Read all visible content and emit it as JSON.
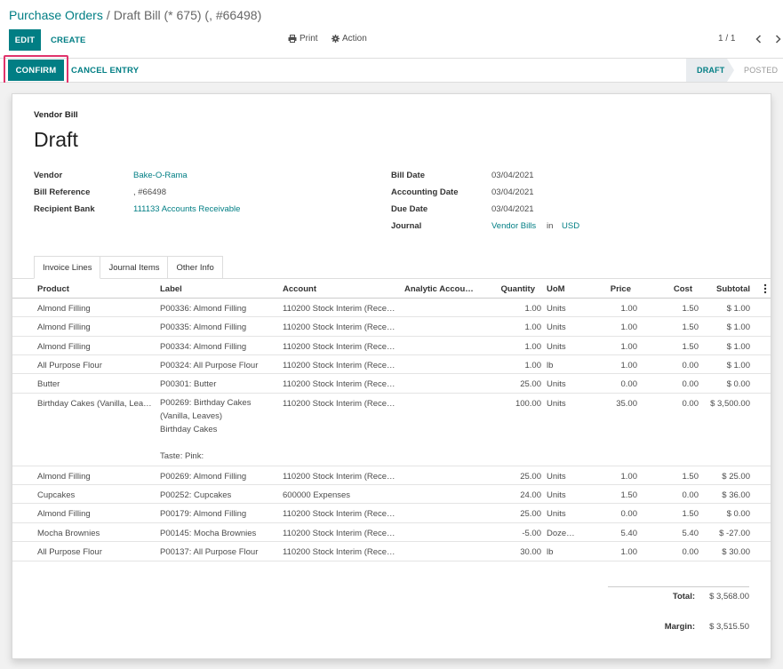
{
  "breadcrumb": {
    "parent": "Purchase Orders",
    "separator": "/",
    "current": "Draft Bill (* 675) (, #66498)"
  },
  "toolbar": {
    "edit_label": "EDIT",
    "create_label": "CREATE",
    "print_label": "Print",
    "action_label": "Action",
    "pager": "1 / 1"
  },
  "statusbar": {
    "confirm_label": "CONFIRM",
    "cancel_label": "CANCEL ENTRY",
    "stages": [
      "DRAFT",
      "POSTED"
    ],
    "active_stage": "DRAFT"
  },
  "form": {
    "doc_type": "Vendor Bill",
    "title": "Draft",
    "left_fields": [
      {
        "label": "Vendor",
        "value": "Bake-O-Rama",
        "link": true
      },
      {
        "label": "Bill Reference",
        "value": ", #66498",
        "link": false
      },
      {
        "label": "Recipient Bank",
        "value": "111133 Accounts Receivable",
        "link": true
      }
    ],
    "right_fields": [
      {
        "label": "Bill Date",
        "value": "03/04/2021"
      },
      {
        "label": "Accounting Date",
        "value": "03/04/2021"
      },
      {
        "label": "Due Date",
        "value": "03/04/2021"
      },
      {
        "label": "Journal",
        "value": "Vendor Bills",
        "in": "in",
        "currency": "USD"
      }
    ]
  },
  "tabs": [
    "Invoice Lines",
    "Journal Items",
    "Other Info"
  ],
  "table": {
    "headers": [
      "Product",
      "Label",
      "Account",
      "Analytic Accou…",
      "Quantity",
      "UoM",
      "Price",
      "Cost",
      "Subtotal"
    ],
    "rows": [
      {
        "product": "Almond Filling",
        "label": "P00336: Almond Filling",
        "account": "110200 Stock Interim (Rece…",
        "qty": "1.00",
        "uom": "Units",
        "price": "1.00",
        "cost": "1.50",
        "subtotal": "$ 1.00"
      },
      {
        "product": "Almond Filling",
        "label": "P00335: Almond Filling",
        "account": "110200 Stock Interim (Rece…",
        "qty": "1.00",
        "uom": "Units",
        "price": "1.00",
        "cost": "1.50",
        "subtotal": "$ 1.00"
      },
      {
        "product": "Almond Filling",
        "label": "P00334: Almond Filling",
        "account": "110200 Stock Interim (Rece…",
        "qty": "1.00",
        "uom": "Units",
        "price": "1.00",
        "cost": "1.50",
        "subtotal": "$ 1.00"
      },
      {
        "product": "All Purpose Flour",
        "label": "P00324: All Purpose Flour",
        "account": "110200 Stock Interim (Rece…",
        "qty": "1.00",
        "uom": "lb",
        "price": "1.00",
        "cost": "0.00",
        "subtotal": "$ 1.00"
      },
      {
        "product": "Butter",
        "label": "P00301: Butter",
        "account": "110200 Stock Interim (Rece…",
        "qty": "25.00",
        "uom": "Units",
        "price": "0.00",
        "cost": "0.00",
        "subtotal": "$ 0.00"
      },
      {
        "product": "Birthday Cakes (Vanilla, Lea…",
        "label_lines": [
          "P00269: Birthday Cakes",
          "(Vanilla, Leaves)",
          "Birthday Cakes",
          "",
          "Taste: Pink:"
        ],
        "account": "110200 Stock Interim (Rece…",
        "qty": "100.00",
        "uom": "Units",
        "price": "35.00",
        "cost": "0.00",
        "subtotal": "$ 3,500.00"
      },
      {
        "product": "Almond Filling",
        "label": "P00269: Almond Filling",
        "account": "110200 Stock Interim (Rece…",
        "qty": "25.00",
        "uom": "Units",
        "price": "1.00",
        "cost": "1.50",
        "subtotal": "$ 25.00"
      },
      {
        "product": "Cupcakes",
        "label": "P00252: Cupcakes",
        "account": "600000 Expenses",
        "qty": "24.00",
        "uom": "Units",
        "price": "1.50",
        "cost": "0.00",
        "subtotal": "$ 36.00"
      },
      {
        "product": "Almond Filling",
        "label": "P00179: Almond Filling",
        "account": "110200 Stock Interim (Rece…",
        "qty": "25.00",
        "uom": "Units",
        "price": "0.00",
        "cost": "1.50",
        "subtotal": "$ 0.00"
      },
      {
        "product": "Mocha Brownies",
        "label": "P00145: Mocha Brownies",
        "account": "110200 Stock Interim (Rece…",
        "qty": "-5.00",
        "uom": "Doze…",
        "price": "5.40",
        "cost": "5.40",
        "subtotal": "$ -27.00"
      },
      {
        "product": "All Purpose Flour",
        "label": "P00137: All Purpose Flour",
        "account": "110200 Stock Interim (Rece…",
        "qty": "30.00",
        "uom": "lb",
        "price": "1.00",
        "cost": "0.00",
        "subtotal": "$ 30.00"
      }
    ]
  },
  "totals": {
    "total_label": "Total:",
    "total_value": "$ 3,568.00",
    "margin_label": "Margin:",
    "margin_value": "$ 3,515.50"
  },
  "colors": {
    "primary": "#017e84",
    "highlight": "#e0336b"
  }
}
